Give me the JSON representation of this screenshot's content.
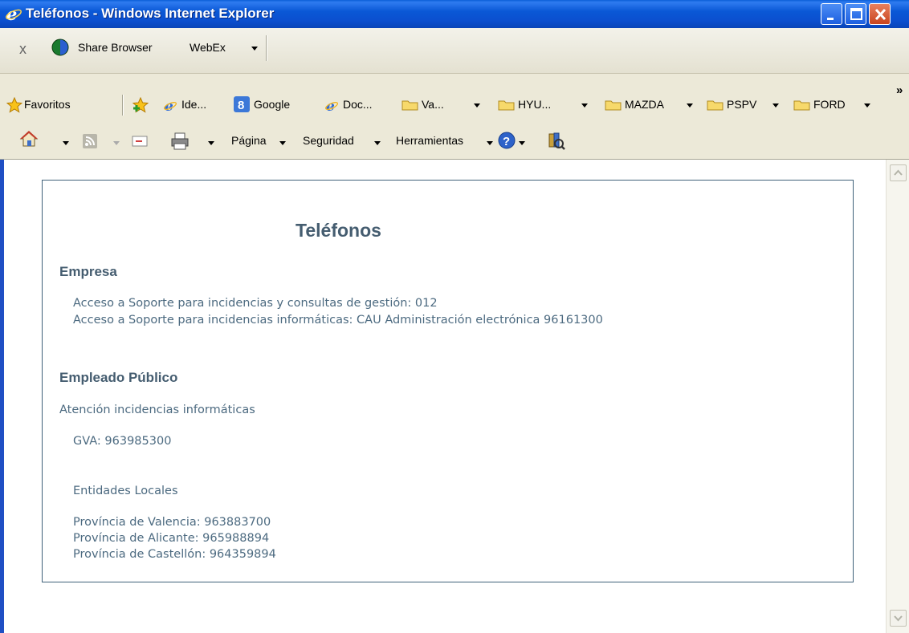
{
  "window": {
    "title": "Teléfonos - Windows Internet Explorer"
  },
  "toolbar1": {
    "close_glyph": "x",
    "share_browser": "Share Browser",
    "webex": "WebEx"
  },
  "favorites_bar": {
    "favorites_label": "Favoritos",
    "items": [
      {
        "label": "Ide..."
      },
      {
        "label": "Google"
      },
      {
        "label": "Doc..."
      },
      {
        "label": "Va..."
      },
      {
        "label": "HYU..."
      },
      {
        "label": "MAZDA"
      },
      {
        "label": "PSPV"
      },
      {
        "label": "FORD"
      }
    ],
    "overflow": "»"
  },
  "command_bar": {
    "pagina": "Página",
    "seguridad": "Seguridad",
    "herramientas": "Herramientas"
  },
  "page": {
    "title": "Teléfonos",
    "empresa": {
      "heading": "Empresa",
      "lines": [
        "Acceso a Soporte para incidencias y consultas de gestión: 012",
        "Acceso a Soporte para incidencias informáticas: CAU Administración electrónica 96161300"
      ]
    },
    "empleado": {
      "heading": "Empleado Público",
      "subheading": "Atención incidencias informáticas",
      "gva": "GVA: 963985300",
      "entidades": "Entidades Locales",
      "provincias": [
        "Província de Valencia: 963883700",
        "Província de Alicante: 965988894",
        "Província de Castellón: 964359894"
      ]
    }
  }
}
